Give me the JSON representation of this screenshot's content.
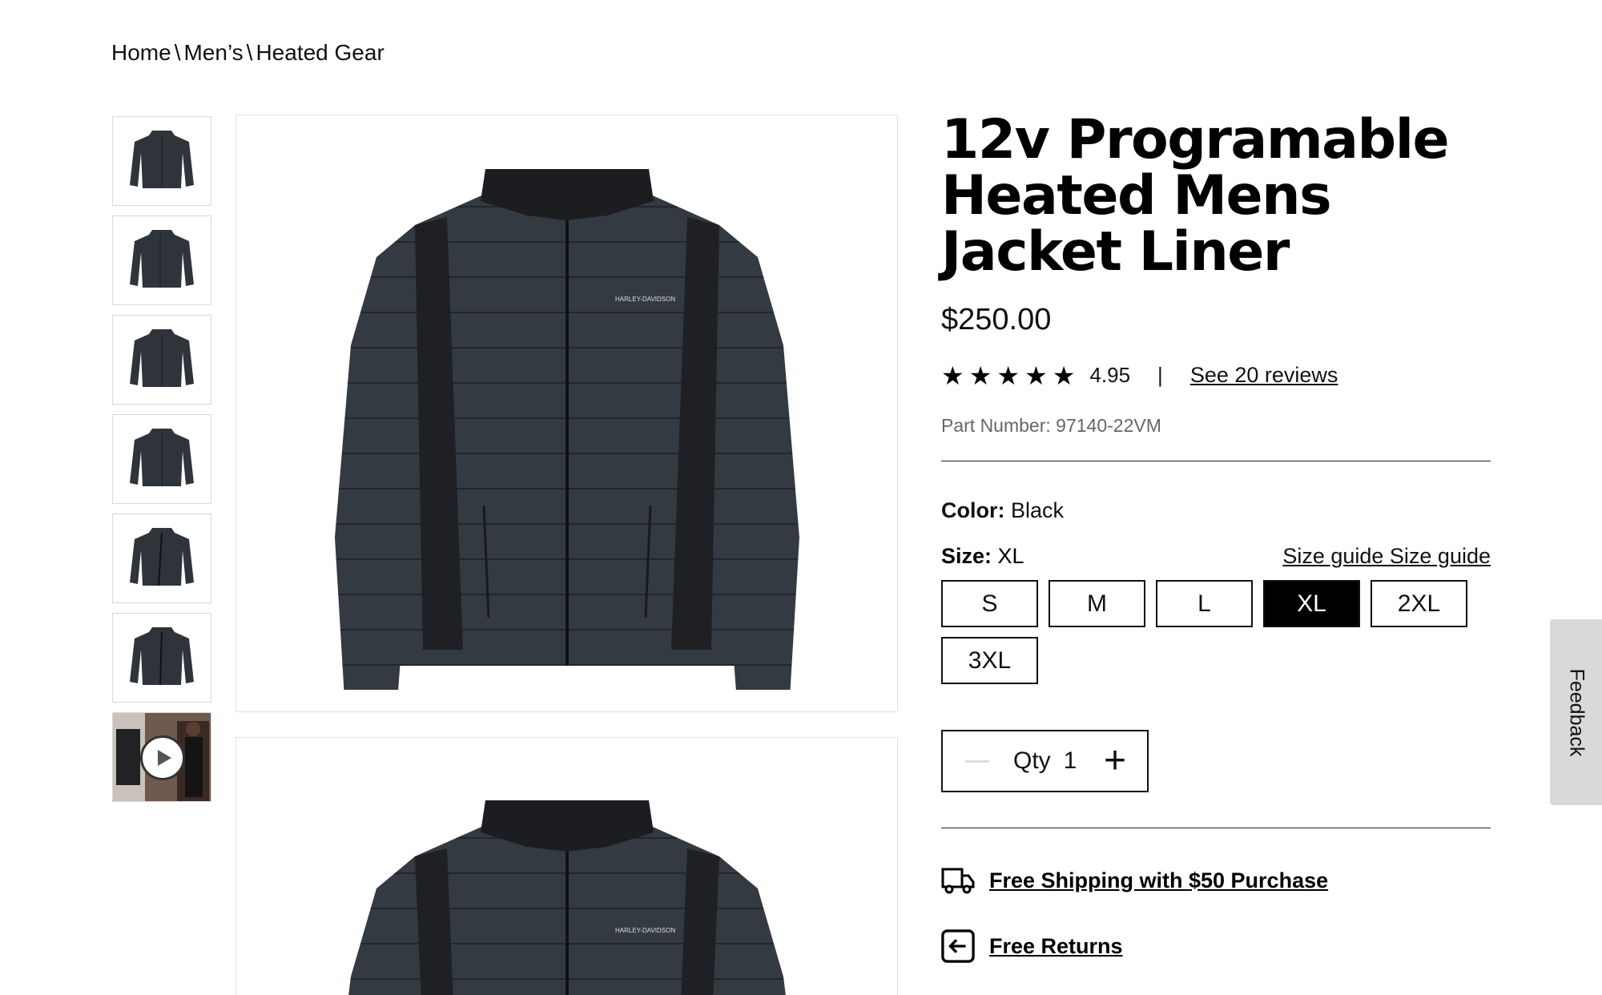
{
  "breadcrumb": {
    "items": [
      "Home",
      "Men’s",
      "Heated Gear"
    ],
    "separator": "\\"
  },
  "product": {
    "title": "12v Programable Heated Mens Jacket Liner",
    "price": "$250.00",
    "rating": {
      "stars": 5,
      "value": "4.95",
      "reviews_link": "See 20 reviews",
      "divider": "|"
    },
    "part_number": "Part Number: 97140-22VM",
    "color": {
      "label": "Color:",
      "value": "Black"
    },
    "size": {
      "label": "Size:",
      "value": "XL",
      "guide_link": "Size guide Size guide",
      "options": [
        "S",
        "M",
        "L",
        "XL",
        "2XL",
        "3XL"
      ],
      "selected": "XL"
    },
    "quantity": {
      "label": "Qty",
      "value": "1",
      "minus": "—",
      "plus": "+"
    },
    "perks": {
      "shipping": "Free Shipping with $50 Purchase",
      "returns": "Free Returns"
    },
    "jacket_logo_text": "HARLEY-DAVIDSON"
  },
  "gallery": {
    "thumbnails": [
      "jacket-front",
      "jacket-front-angle",
      "jacket-front",
      "jacket-front",
      "jacket-open",
      "jacket-open"
    ],
    "video_thumbnail": "play-icon"
  },
  "feedback_tab": "Feedback",
  "colors": {
    "accent": "#000000",
    "selected_size_bg": "#000000",
    "feedback_bg": "#d9d9d9",
    "jacket": "#2f343b"
  }
}
